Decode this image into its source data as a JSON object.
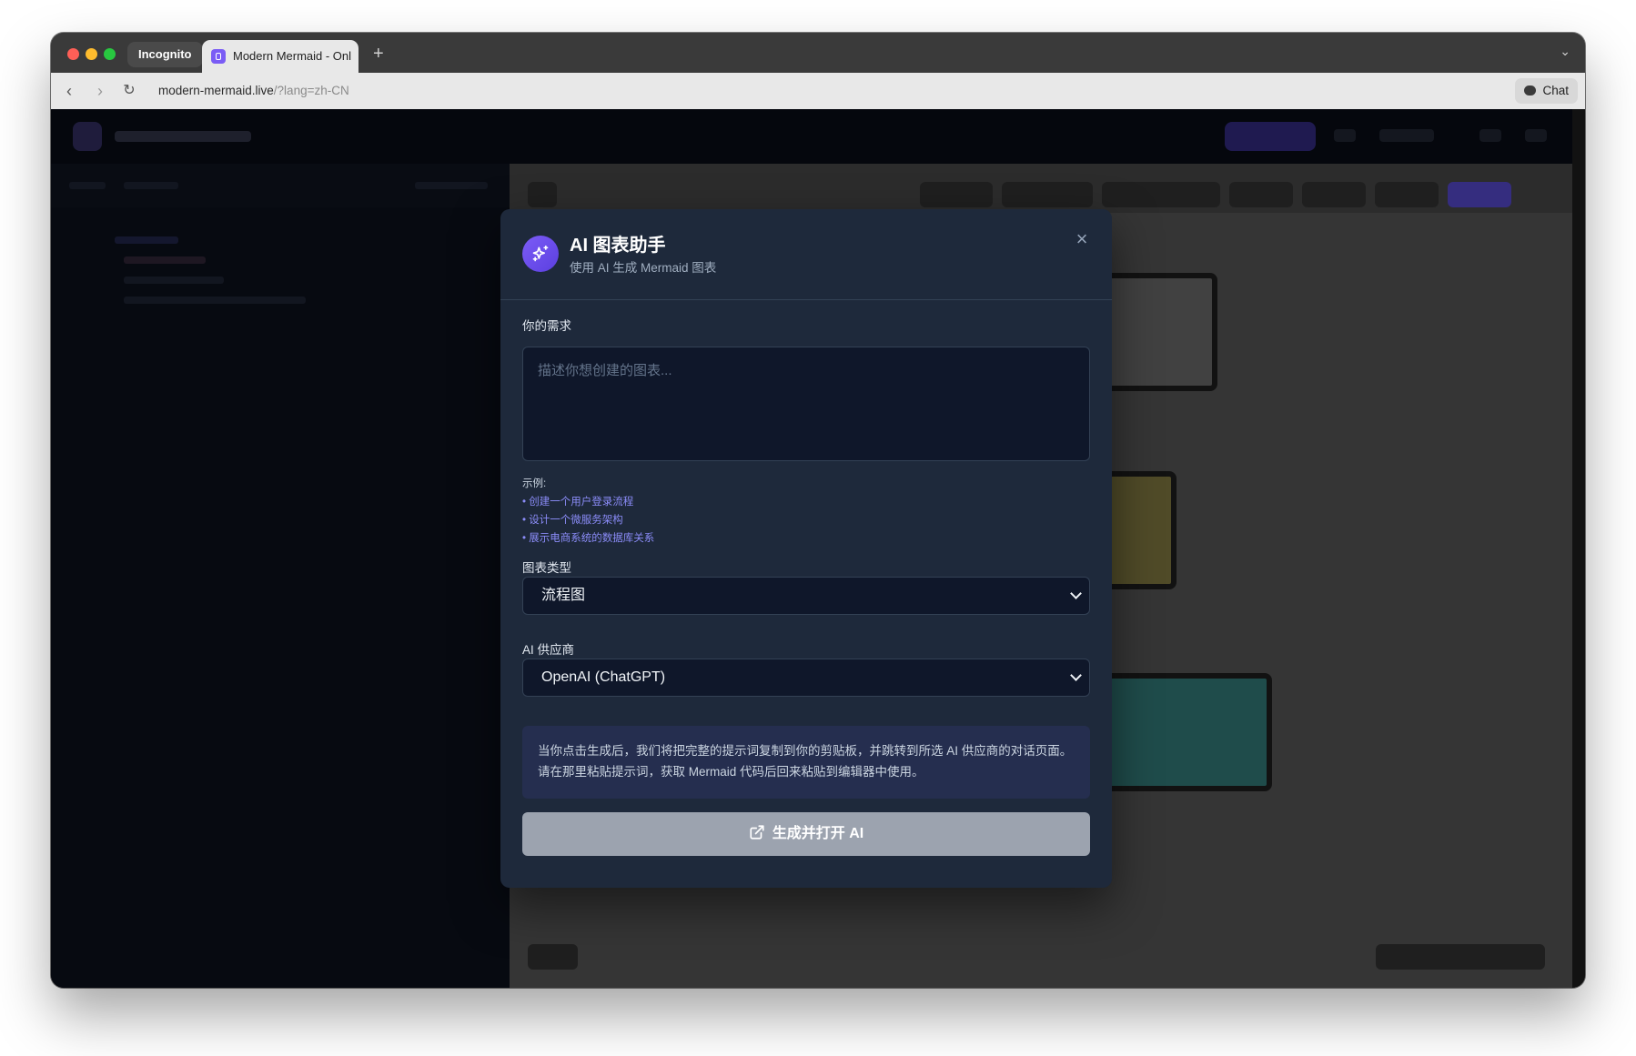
{
  "browser": {
    "incognito_label": "Incognito",
    "tab_title": "Modern Mermaid - Onl",
    "new_tab": "+",
    "url_main": "modern-mermaid.live",
    "url_query": "/?lang=zh-CN",
    "chat_label": "Chat"
  },
  "modal": {
    "title": "AI 图表助手",
    "subtitle": "使用 AI 生成 Mermaid 图表",
    "close": "×",
    "request_label": "你的需求",
    "request_placeholder": "描述你想创建的图表...",
    "request_value": "",
    "examples_title": "示例:",
    "examples": [
      "• 创建一个用户登录流程",
      "• 设计一个微服务架构",
      "• 展示电商系统的数据库关系"
    ],
    "diagram_type_label": "图表类型",
    "diagram_type_value": "流程图",
    "provider_label": "AI 供应商",
    "provider_value": "OpenAI (ChatGPT)",
    "info_text": "当你点击生成后，我们将把完整的提示词复制到你的剪贴板，并跳转到所选 AI 供应商的对话页面。请在那里粘贴提示词，获取 Mermaid 代码后回来粘贴到编辑器中使用。",
    "generate_label": "生成并打开 AI"
  },
  "colors": {
    "modal_bg": "#1e293b",
    "accent": "#6d4ef0",
    "link": "#8b8cf8",
    "button_disabled": "#9ca3af"
  },
  "icons": {
    "modal_icon": "sparkles-icon",
    "generate_icon": "external-link-icon",
    "close_icon": "close-icon"
  }
}
